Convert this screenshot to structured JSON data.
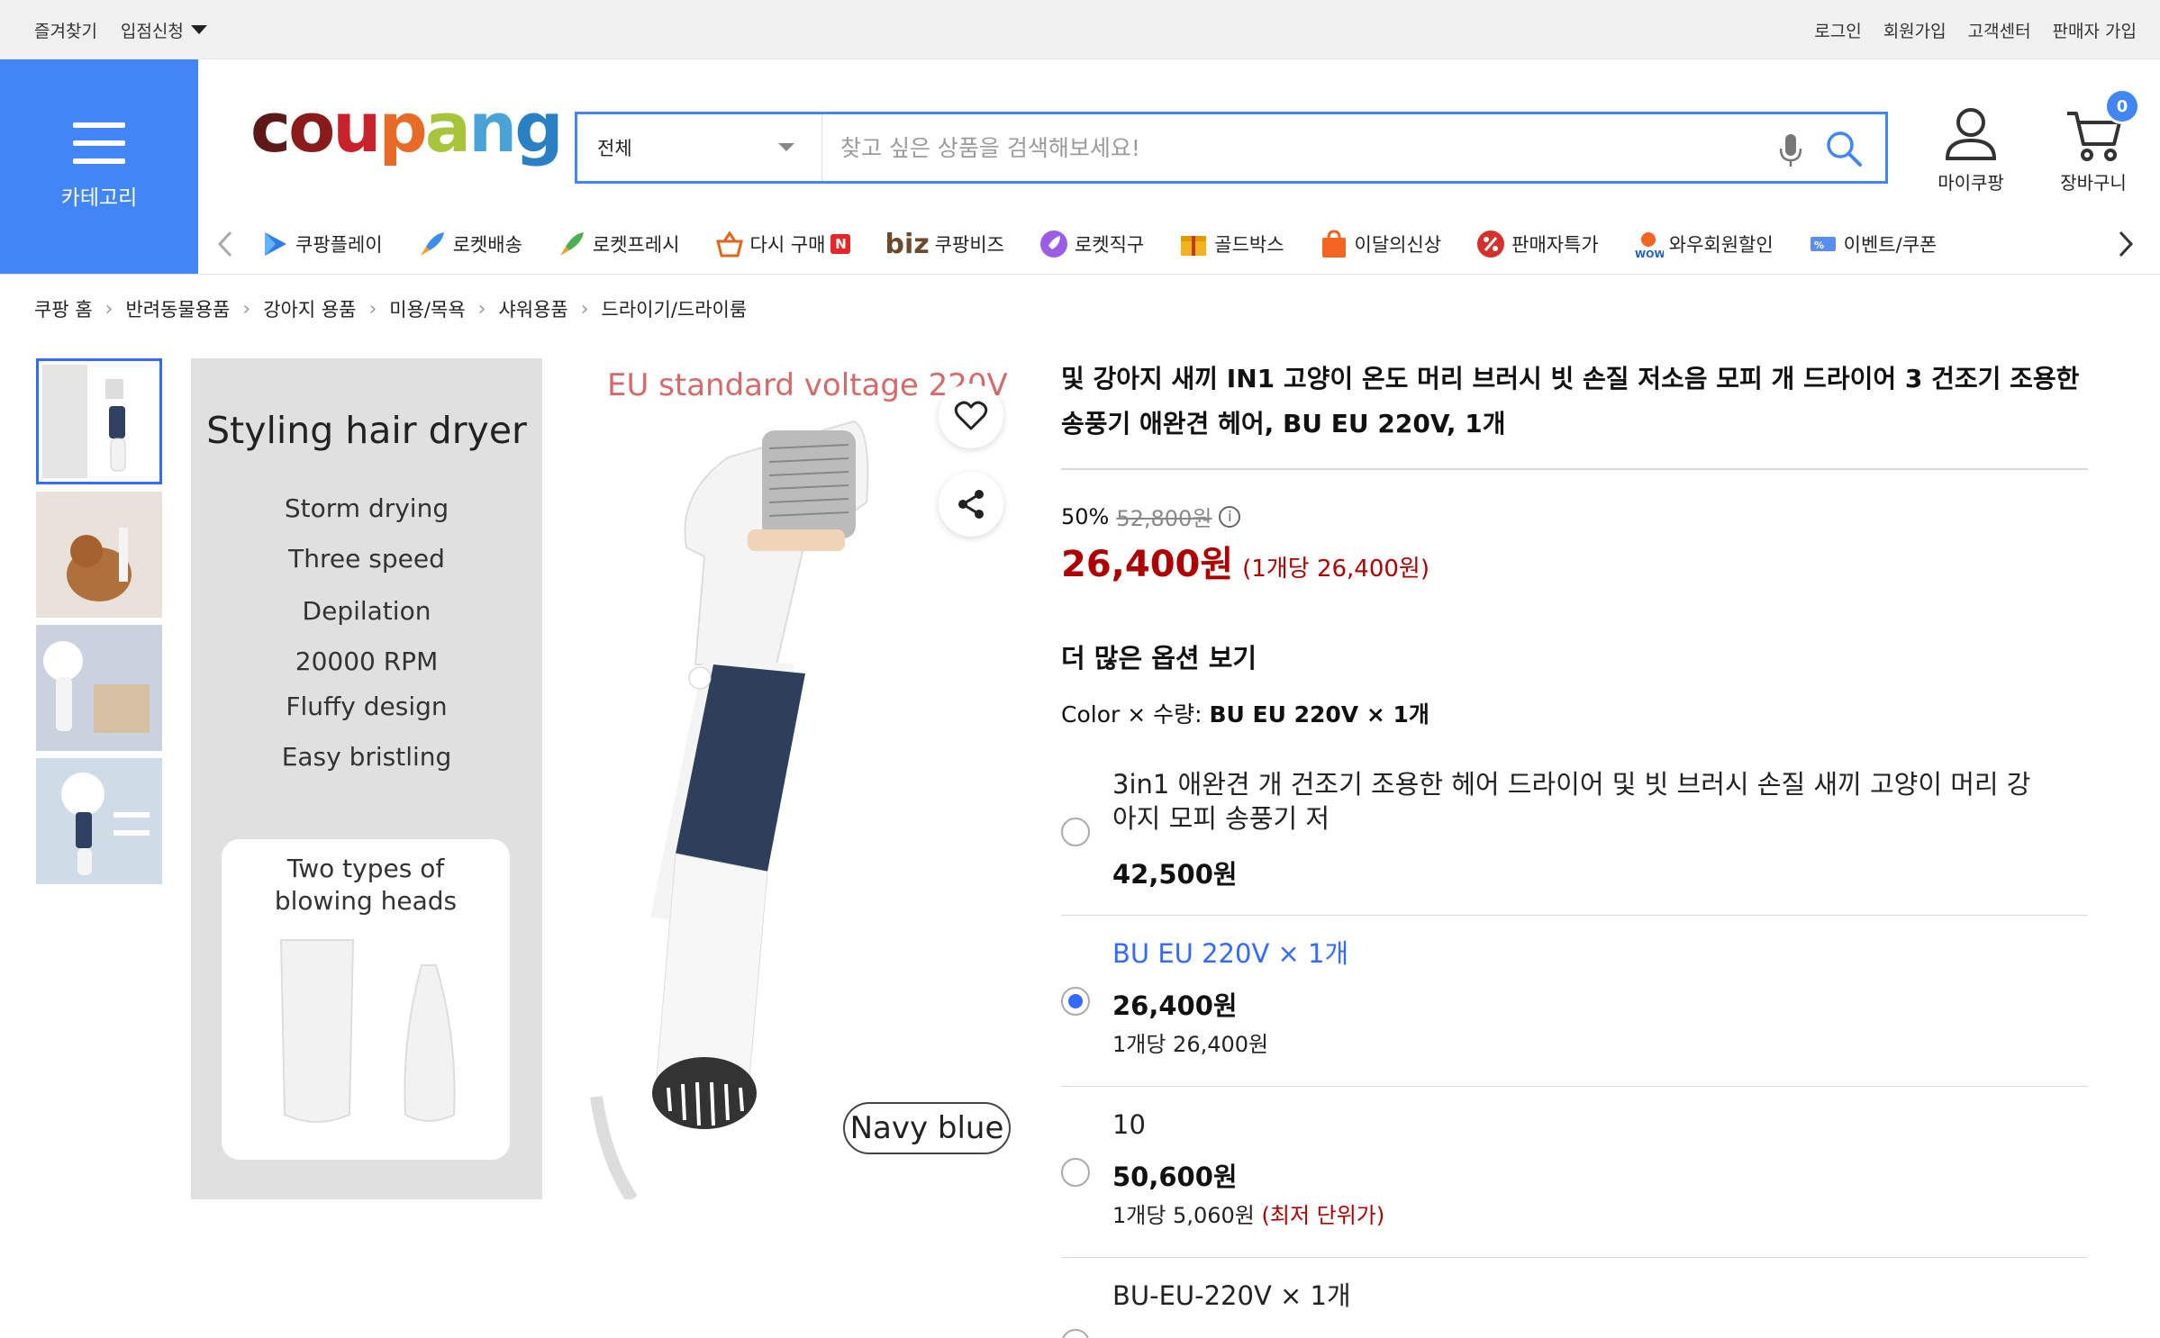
{
  "topbar": {
    "bookmark": "즐겨찾기",
    "seller_apply": "입점신청",
    "login": "로그인",
    "signup": "회원가입",
    "customer_center": "고객센터",
    "seller_join": "판매자 가입"
  },
  "header": {
    "category_label": "카테고리",
    "logo": "coupang",
    "search": {
      "scope": "전체",
      "placeholder": "찾고 싶은 상품을 검색해보세요!"
    },
    "my_coupang": "마이쿠팡",
    "cart_label": "장바구니",
    "cart_count": "0"
  },
  "nav": {
    "items": [
      {
        "label": "쿠팡플레이",
        "icon": "play-icon"
      },
      {
        "label": "로켓배송",
        "icon": "rocket-icon"
      },
      {
        "label": "로켓프레시",
        "icon": "rocket-fresh-icon"
      },
      {
        "label": "다시 구매",
        "icon": "rebuy-basket-icon",
        "badge": "N"
      },
      {
        "label": "쿠팡비즈",
        "icon": "biz-icon",
        "prefix": "biz"
      },
      {
        "label": "로켓직구",
        "icon": "rocket-global-icon"
      },
      {
        "label": "골드박스",
        "icon": "goldbox-icon"
      },
      {
        "label": "이달의신상",
        "icon": "new-bag-icon"
      },
      {
        "label": "판매자특가",
        "icon": "seller-deal-icon"
      },
      {
        "label": "와우회원할인",
        "icon": "wow-icon"
      },
      {
        "label": "이벤트/쿠폰",
        "icon": "coupon-icon"
      }
    ]
  },
  "breadcrumb": [
    "쿠팡 홈",
    "반려동물용품",
    "강아지 용품",
    "미용/목욕",
    "샤워용품",
    "드라이기/드라이룸"
  ],
  "gallery": {
    "panel_title": "Styling hair dryer",
    "features": [
      "Storm drying",
      "Three speed",
      "Depilation",
      "20000 RPM",
      "Fluffy design",
      "Easy bristling"
    ],
    "box_title_1": "Two types of",
    "box_title_2": "blowing heads",
    "voltage_text": "EU standard voltage 220V",
    "color_tag": "Navy blue"
  },
  "product": {
    "title": "및 강아지 새끼 IN1 고양이 온도 머리 브러시 빗 손질 저소음 모피 개 드라이어 3 건조기 조용한 송풍기 애완견 헤어, BU EU 220V, 1개",
    "discount": "50%",
    "original_price": "52,800원",
    "price": "26,400원",
    "unit_price": "(1개당 26,400원)",
    "more_options": "더 많은 옵션 보기",
    "option_label": "Color × 수량: ",
    "option_selected": "BU EU 220V × 1개",
    "options": [
      {
        "name": "3in1 애완견 개 건조기 조용한 헤어 드라이어 및 빗 브러시 손질 새끼 고양이 머리 강아지 모피 송풍기 저",
        "price": "42,500원"
      },
      {
        "name": "BU EU 220V × 1개",
        "price": "26,400원",
        "per": "1개당 26,400원"
      },
      {
        "name": "10",
        "price": "50,600원",
        "per": "1개당 5,060원",
        "lowest": "(최저 단위가)"
      },
      {
        "name": "BU-EU-220V × 1개"
      }
    ]
  },
  "colors": {
    "accent": "#4285f4",
    "price_red": "#ae0000",
    "selected_blue": "#346aff"
  }
}
